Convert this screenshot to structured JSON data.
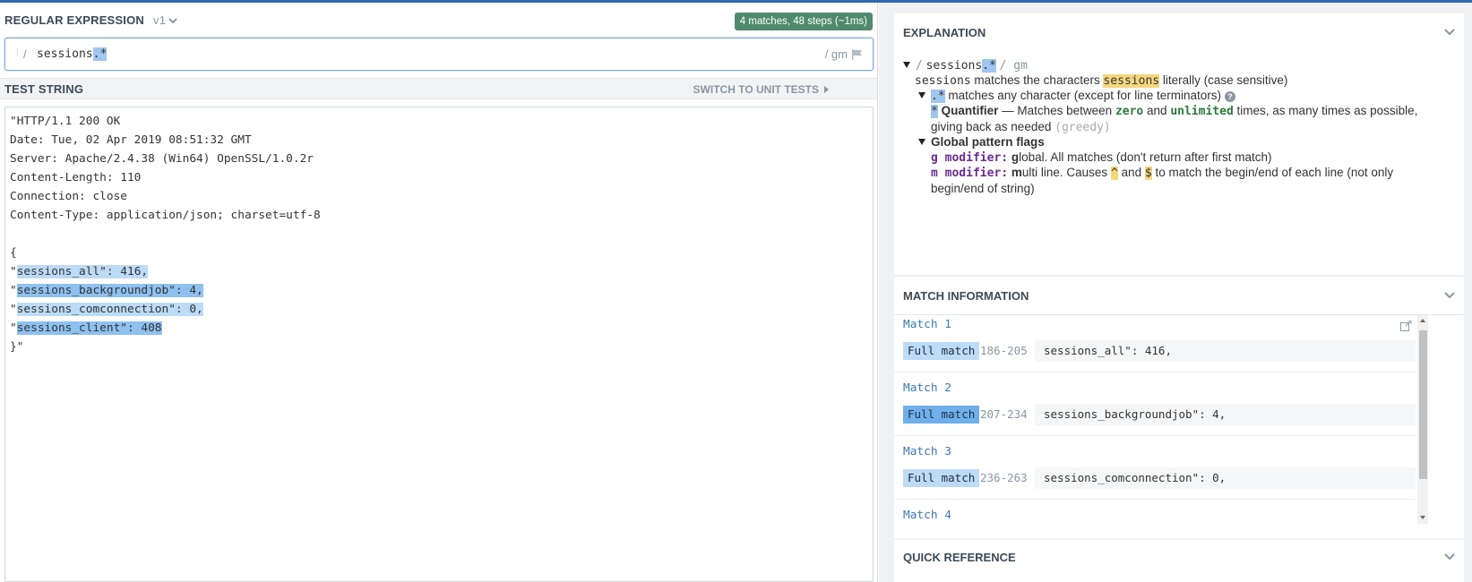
{
  "regex": {
    "section_title": "REGULAR EXPRESSION",
    "flavor": "v1",
    "match_badge": "4 matches, 48 steps (~1ms)",
    "delimiter_open": "/",
    "pattern_plain": "sessions",
    "pattern_hl": ".*",
    "flags": "/ gm"
  },
  "test_string": {
    "section_title": "TEST STRING",
    "switch_label": "SWITCH TO UNIT TESTS",
    "lines": [
      "\"HTTP/1.1 200 OK",
      "Date: Tue, 02 Apr 2019 08:51:32 GMT",
      "Server: Apache/2.4.38 (Win64) OpenSSL/1.0.2r",
      "Content-Length: 110",
      "Connection: close",
      "Content-Type: application/json; charset=utf-8",
      "",
      "{",
      "\"",
      "\"",
      "\"",
      "\"",
      "}\""
    ],
    "matches": [
      "sessions_all\": 416,",
      "sessions_backgroundjob\": 4,",
      "sessions_comconnection\": 0,",
      "sessions_client\": 408"
    ]
  },
  "explanation": {
    "title": "EXPLANATION",
    "root_open": "/",
    "root_sessions": "sessions",
    "root_dotstar": ".*",
    "root_flags": "/ gm",
    "l1_token": "sessions",
    "l1_text_a": "matches the characters",
    "l1_hl": "sessions",
    "l1_text_b": "literally (case sensitive)",
    "l2_token": ".*",
    "l2_text": "matches any character (except for line terminators)",
    "l3_star": "*",
    "l3_quant": "Quantifier",
    "l3_dash": "— Matches between",
    "l3_zero": "zero",
    "l3_and": "and",
    "l3_unlimited": "unlimited",
    "l3_rest": "times, as many times as possible,",
    "l3_line2": "giving back as needed",
    "l3_greedy": "(greedy)",
    "flags_title": "Global pattern flags",
    "g_mod": "g modifier:",
    "g_bold": "g",
    "g_text": "lobal. All matches (don't return after first match)",
    "m_mod": "m modifier:",
    "m_bold": "m",
    "m_text_a": "ulti line. Causes",
    "m_caret": "^",
    "m_and": "and",
    "m_dollar": "$",
    "m_text_b": "to match the begin/end of each line (not only",
    "m_line2": "begin/end of string)"
  },
  "match_info": {
    "title": "MATCH INFORMATION",
    "tag": "Full match",
    "items": [
      {
        "title": "Match 1",
        "range": "186-205",
        "value": "sessions_all\": 416,"
      },
      {
        "title": "Match 2",
        "range": "207-234",
        "value": "sessions_backgroundjob\": 4,"
      },
      {
        "title": "Match 3",
        "range": "236-263",
        "value": "sessions_comconnection\": 0,"
      },
      {
        "title": "Match 4"
      }
    ]
  },
  "quick_reference": {
    "title": "QUICK REFERENCE"
  },
  "colors": {
    "accent": "#2d6bb3",
    "badge": "#4f8a6e",
    "highlight_light": "#bcdbf7",
    "highlight_dark": "#8ec1f0",
    "token_blue": "#9fc6ef",
    "token_yellow": "#f6d77e"
  },
  "icons": [
    "chevron-down-icon",
    "flag-icon",
    "caret-right-icon",
    "help-icon",
    "share-icon"
  ]
}
